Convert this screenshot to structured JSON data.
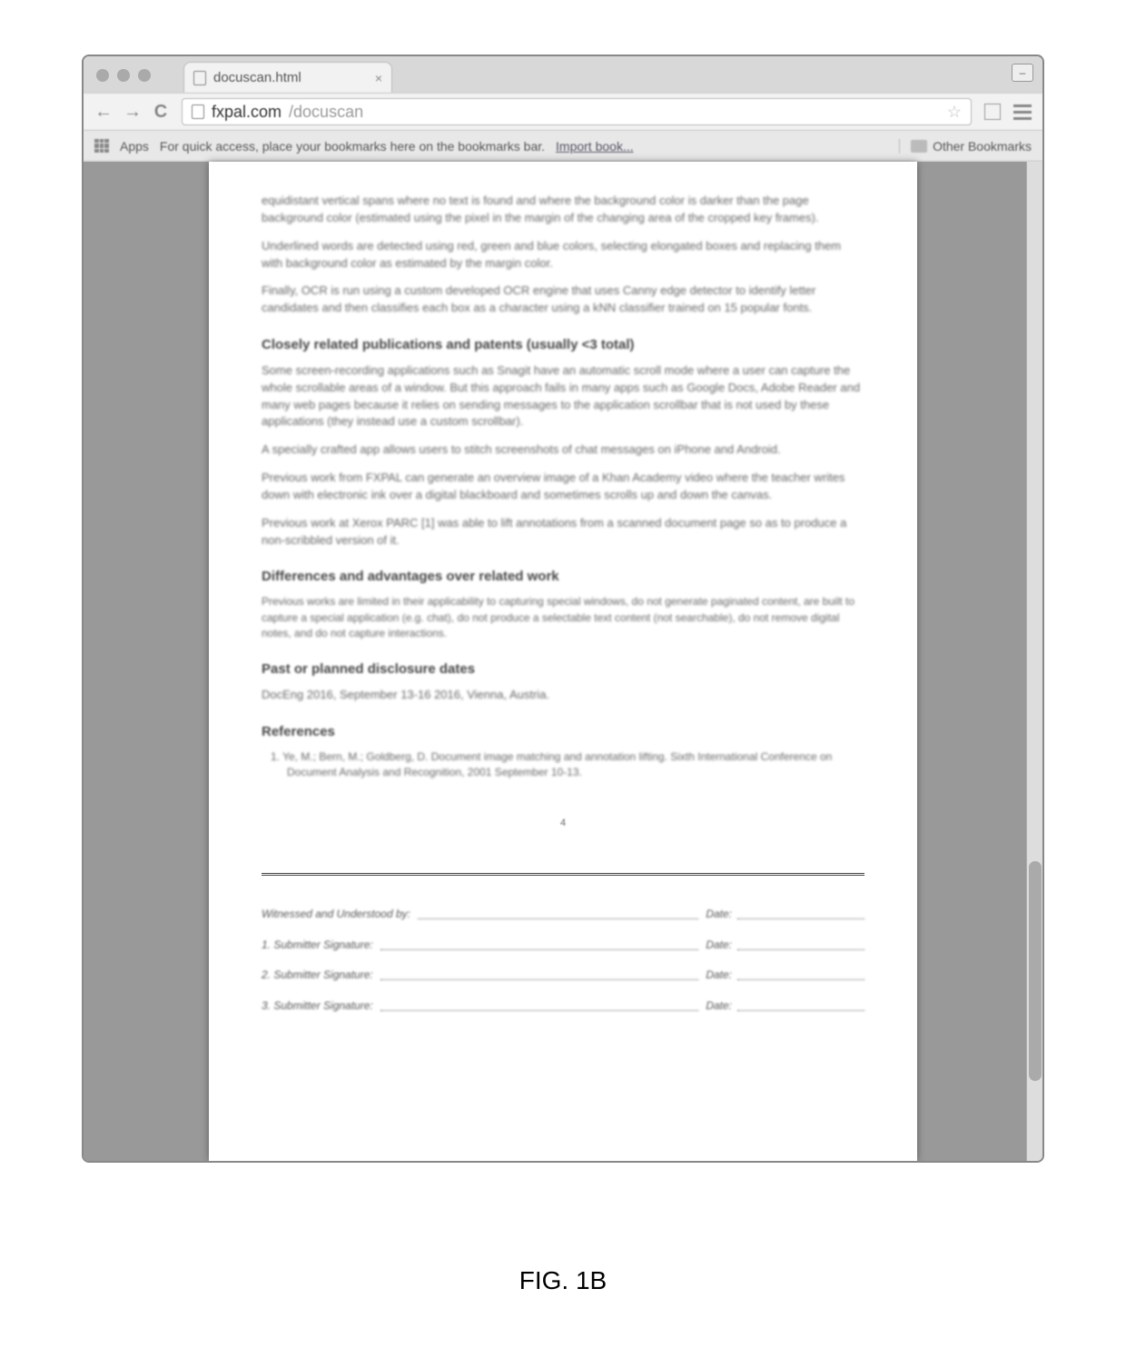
{
  "browser": {
    "tab": {
      "title": "docuscan.html"
    },
    "address": {
      "domain": "fxpal.com",
      "path": "/docuscan"
    },
    "bookmarks": {
      "apps_label": "Apps",
      "hint": "For quick access, place your bookmarks here on the bookmarks bar.",
      "import_link": "Import book...",
      "other_label": "Other Bookmarks"
    }
  },
  "doc": {
    "p1": "equidistant vertical spans where no text is found and where the background color is darker than the page background color (estimated using the pixel in the margin of the changing area of the cropped key frames).",
    "p2": "Underlined words are detected using red, green and blue colors, selecting elongated boxes and replacing them with background color as estimated by the margin color.",
    "p3": "Finally, OCR is run using a custom developed OCR engine that uses Canny edge detector to identify letter candidates and then classifies each box as a character using a kNN classifier trained on 15 popular fonts.",
    "h1": "Closely related publications and patents (usually <3 total)",
    "p4": "Some screen-recording applications such as Snagit have an automatic scroll mode where a user can capture the whole scrollable areas of a window. But this approach fails in many apps such as Google Docs, Adobe Reader and many web pages because it relies on sending messages to the application scrollbar that is not used by these applications (they instead use a custom scrollbar).",
    "p5": "A specially crafted app allows users to stitch screenshots of chat messages on iPhone and Android.",
    "p6": "Previous work from FXPAL can generate an overview image of a Khan Academy video where the teacher writes down with electronic ink over a digital blackboard and sometimes scrolls up and down the canvas.",
    "p7": "Previous work at Xerox PARC [1] was able to lift annotations from a scanned document page so as to produce a non-scribbled version of it.",
    "h2": "Differences and advantages over related work",
    "p8": "Previous works are limited in their applicability to capturing special windows, do not generate paginated content, are built to capture a special application (e.g. chat), do not produce a selectable text content (not searchable), do not remove digital notes, and do not capture interactions.",
    "h3": "Past or planned disclosure dates",
    "p9": "DocEng 2016, September 13-16 2016, Vienna, Austria.",
    "h4": "References",
    "ref1": "1.  Ye, M.; Bern, M.; Goldberg, D. Document image matching and annotation lifting. Sixth International Conference on Document Analysis and Recognition, 2001 September 10-13.",
    "pagenum": "4",
    "sig": {
      "witness": "Witnessed and Understood by:",
      "s1": "1. Submitter Signature:",
      "s2": "2. Submitter Signature:",
      "s3": "3. Submitter Signature:",
      "date": "Date:"
    }
  },
  "figure_label": "FIG. 1B"
}
